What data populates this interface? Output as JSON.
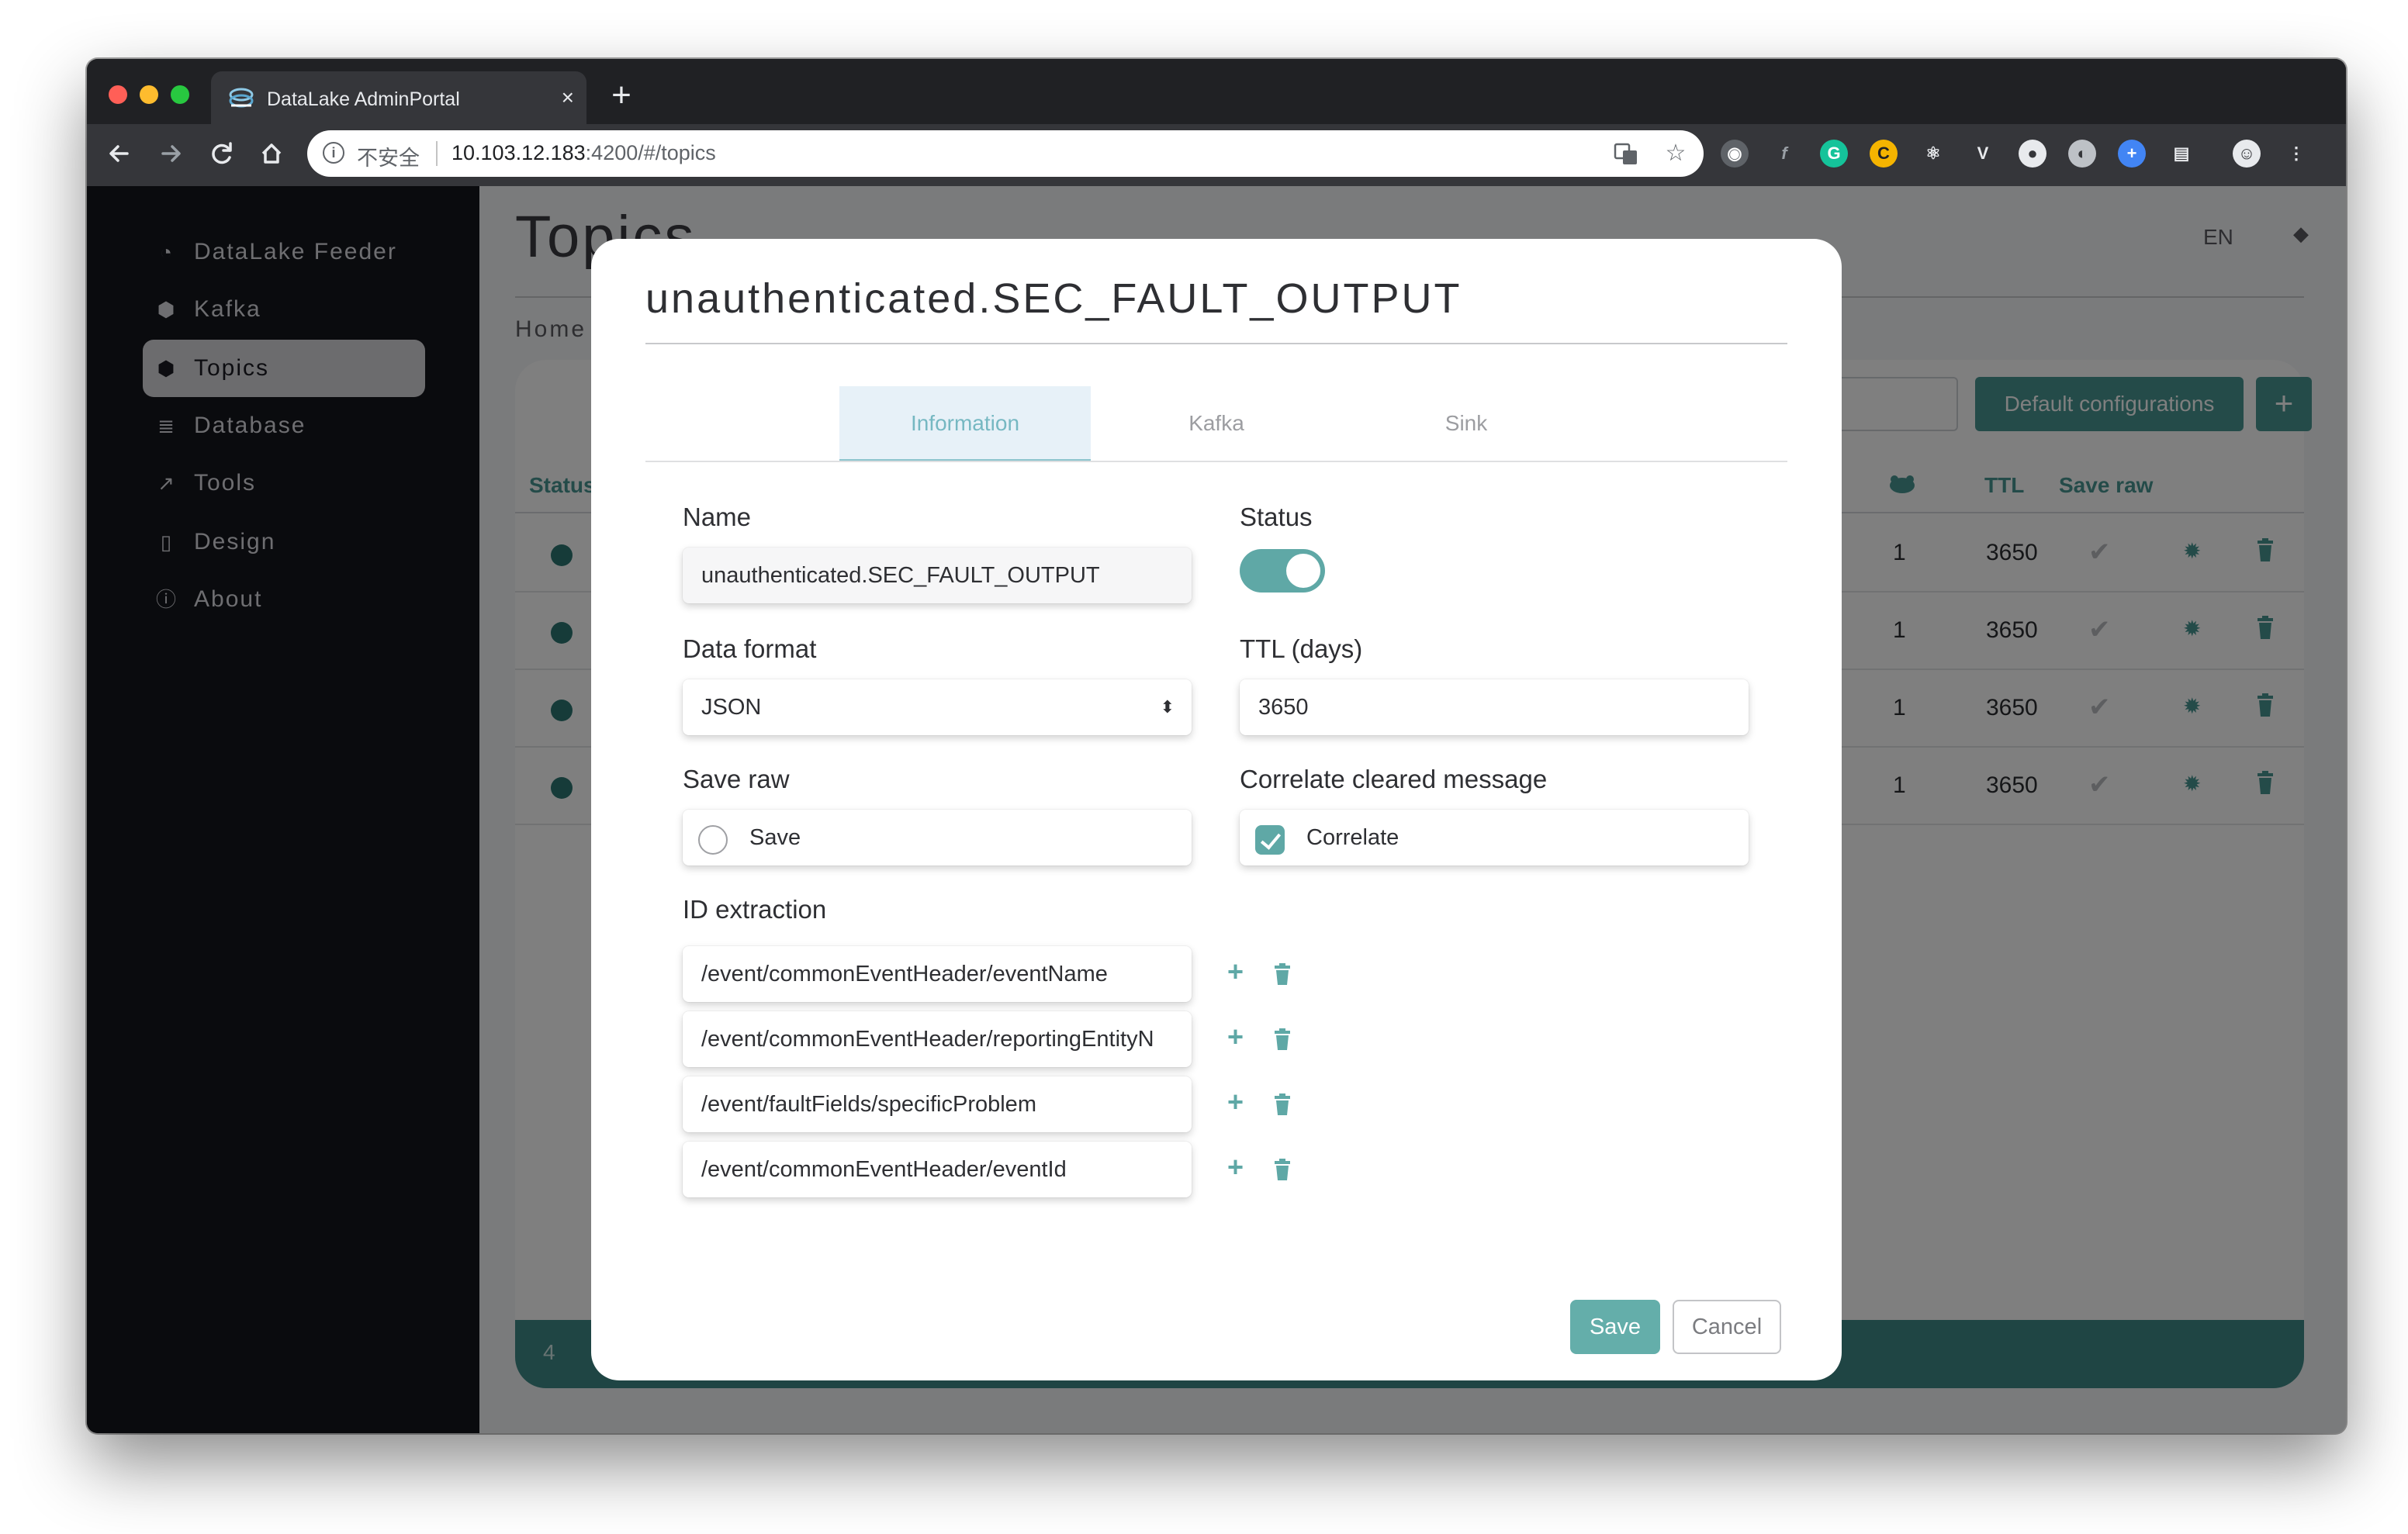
{
  "browser": {
    "tab_title": "DataLake AdminPortal",
    "tab_close": "×",
    "new_tab": "+",
    "insecure_label": "不安全",
    "url_host": "10.103.12.183",
    "url_rest": ":4200/#/topics",
    "icons": [
      "back-icon",
      "forward-icon",
      "reload-icon",
      "home-icon"
    ]
  },
  "sidebar": {
    "items": [
      {
        "label": "DataLake Feeder",
        "icon": "dashboard-icon"
      },
      {
        "label": "Kafka",
        "icon": "cube-icon"
      },
      {
        "label": "Topics",
        "icon": "cube-icon"
      },
      {
        "label": "Database",
        "icon": "database-icon"
      },
      {
        "label": "Tools",
        "icon": "external-link-icon"
      },
      {
        "label": "Design",
        "icon": "file-icon"
      },
      {
        "label": "About",
        "icon": "info-icon"
      }
    ],
    "active_index": 2
  },
  "page": {
    "title": "Topics",
    "breadcrumb": "Home",
    "lang": "EN",
    "lang_arrows": "◆"
  },
  "table": {
    "default_configs_button": "Default configurations",
    "add_button": "+",
    "status_header": "Status",
    "ttl_header": "TTL",
    "save_raw_header": "Save raw",
    "rows": [
      {
        "count": "1",
        "ttl": "3650"
      },
      {
        "count": "1",
        "ttl": "3650"
      },
      {
        "count": "1",
        "ttl": "3650"
      },
      {
        "count": "1",
        "ttl": "3650"
      }
    ],
    "footer_count": "4"
  },
  "modal": {
    "title": "unauthenticated.SEC_FAULT_OUTPUT",
    "tabs": [
      "Information",
      "Kafka",
      "Sink"
    ],
    "active_tab": 0,
    "name_label": "Name",
    "name_value": "unauthenticated.SEC_FAULT_OUTPUT",
    "status_label": "Status",
    "status_on": true,
    "data_format_label": "Data format",
    "data_format_value": "JSON",
    "ttl_label": "TTL (days)",
    "ttl_value": "3650",
    "save_raw_label": "Save raw",
    "save_checkbox_label": "Save",
    "save_checked": false,
    "correlate_label": "Correlate cleared message",
    "correlate_checkbox_label": "Correlate",
    "correlate_checked": true,
    "id_extraction_label": "ID extraction",
    "id_extractions": [
      "/event/commonEventHeader/eventName",
      "/event/commonEventHeader/reportingEntityN",
      "/event/faultFields/specificProblem",
      "/event/commonEventHeader/eventId"
    ],
    "add_icon": "+",
    "save_button": "Save",
    "cancel_button": "Cancel"
  },
  "colors": {
    "accent": "#499693",
    "accent_light": "#64aeaa",
    "sidebar_bg": "#15161d"
  }
}
